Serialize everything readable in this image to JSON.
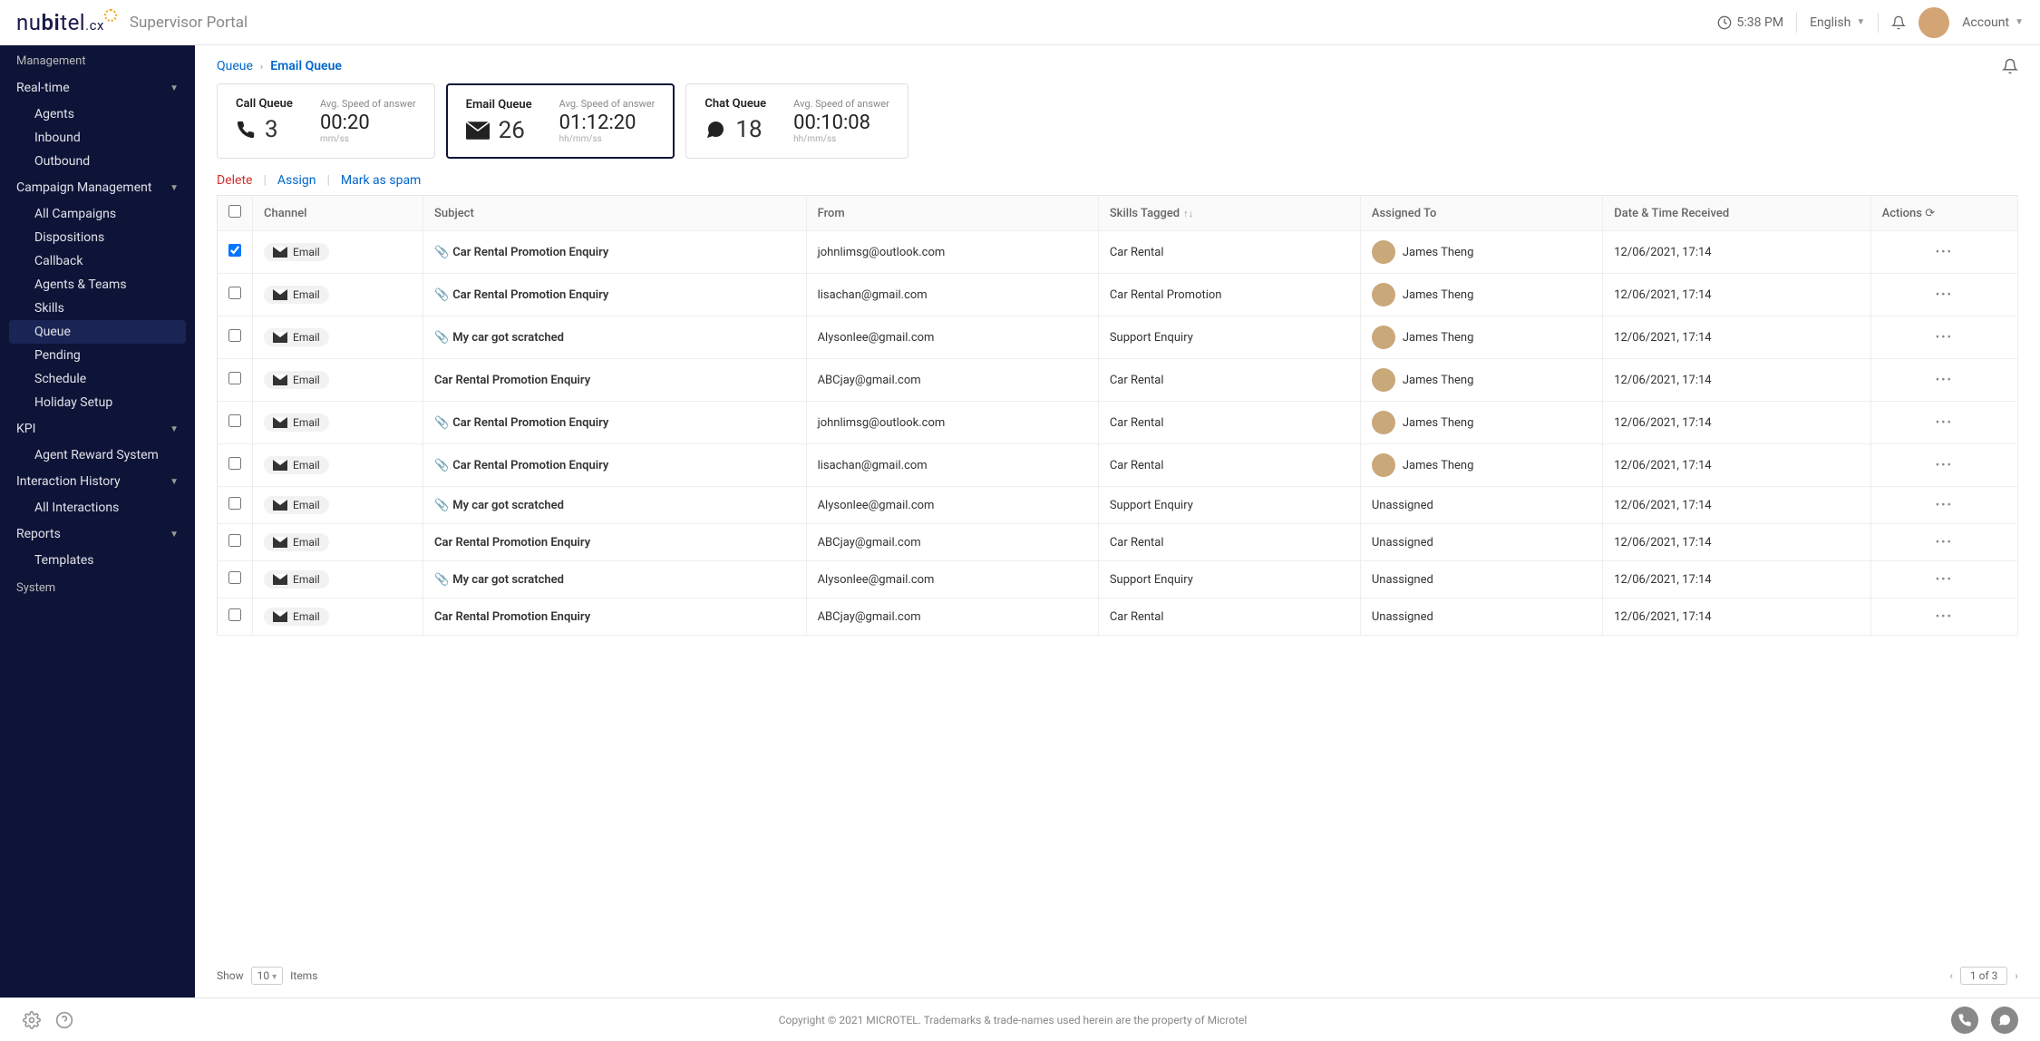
{
  "header": {
    "brand_a": "nu",
    "brand_b": "bi",
    "brand_c": "tel",
    "brand_sub": ".cx",
    "portal_title": "Supervisor Portal",
    "time": "5:38 PM",
    "language": "English",
    "account": "Account"
  },
  "breadcrumb": {
    "root": "Queue",
    "current": "Email Queue"
  },
  "sidebar": {
    "section_management": "Management",
    "groups": {
      "realtime": {
        "label": "Real-time",
        "items": [
          "Agents",
          "Inbound",
          "Outbound"
        ]
      },
      "campaign": {
        "label": "Campaign Management",
        "items": [
          "All Campaigns",
          "Dispositions",
          "Callback",
          "Agents & Teams",
          "Skills",
          "Queue",
          "Pending",
          "Schedule",
          "Holiday Setup"
        ]
      },
      "kpi": {
        "label": "KPI",
        "items": [
          "Agent Reward System"
        ]
      },
      "history": {
        "label": "Interaction History",
        "items": [
          "All Interactions"
        ]
      },
      "reports": {
        "label": "Reports",
        "items": [
          "Templates"
        ]
      }
    },
    "section_system": "System",
    "active_sub": "Queue"
  },
  "cards": [
    {
      "title": "Call Queue",
      "icon": "phone",
      "count": "3",
      "sublabel": "Avg. Speed of answer",
      "time": "00:20",
      "format": "mm/ss",
      "active": false
    },
    {
      "title": "Email Queue",
      "icon": "mail",
      "count": "26",
      "sublabel": "Avg. Speed of answer",
      "time": "01:12:20",
      "format": "hh/mm/ss",
      "active": true
    },
    {
      "title": "Chat Queue",
      "icon": "chat",
      "count": "18",
      "sublabel": "Avg. Speed of answer",
      "time": "00:10:08",
      "format": "hh/mm/ss",
      "active": false
    }
  ],
  "actions": {
    "delete": "Delete",
    "assign": "Assign",
    "spam": "Mark as spam"
  },
  "table": {
    "headers": {
      "channel": "Channel",
      "subject": "Subject",
      "from": "From",
      "skills": "Skills Tagged",
      "assigned": "Assigned To",
      "date": "Date & Time Received",
      "actions": "Actions"
    },
    "rows": [
      {
        "checked": true,
        "channel": "Email",
        "attach": true,
        "subject": "Car Rental Promotion Enquiry",
        "from": "johnlimsg@outlook.com",
        "skills": "Car Rental",
        "assigned": "James Theng",
        "avatar": true,
        "date": "12/06/2021, 17:14"
      },
      {
        "checked": false,
        "channel": "Email",
        "attach": true,
        "subject": "Car Rental Promotion Enquiry",
        "from": "lisachan@gmail.com",
        "skills": "Car Rental Promotion",
        "assigned": "James Theng",
        "avatar": true,
        "date": "12/06/2021, 17:14"
      },
      {
        "checked": false,
        "channel": "Email",
        "attach": true,
        "subject": "My car got scratched",
        "from": "Alysonlee@gmail.com",
        "skills": "Support Enquiry",
        "assigned": "James Theng",
        "avatar": true,
        "date": "12/06/2021, 17:14"
      },
      {
        "checked": false,
        "channel": "Email",
        "attach": false,
        "subject": "Car Rental Promotion Enquiry",
        "from": "ABCjay@gmail.com",
        "skills": "Car Rental",
        "assigned": "James Theng",
        "avatar": true,
        "date": "12/06/2021, 17:14"
      },
      {
        "checked": false,
        "channel": "Email",
        "attach": true,
        "subject": "Car Rental Promotion Enquiry",
        "from": "johnlimsg@outlook.com",
        "skills": "Car Rental",
        "assigned": "James Theng",
        "avatar": true,
        "date": "12/06/2021, 17:14"
      },
      {
        "checked": false,
        "channel": "Email",
        "attach": true,
        "subject": "Car Rental Promotion Enquiry",
        "from": "lisachan@gmail.com",
        "skills": "Car Rental",
        "assigned": "James Theng",
        "avatar": true,
        "date": "12/06/2021, 17:14"
      },
      {
        "checked": false,
        "channel": "Email",
        "attach": true,
        "subject": "My car got scratched",
        "from": "Alysonlee@gmail.com",
        "skills": "Support Enquiry",
        "assigned": "Unassigned",
        "avatar": false,
        "date": "12/06/2021, 17:14"
      },
      {
        "checked": false,
        "channel": "Email",
        "attach": false,
        "subject": "Car Rental Promotion Enquiry",
        "from": "ABCjay@gmail.com",
        "skills": "Car Rental",
        "assigned": "Unassigned",
        "avatar": false,
        "date": "12/06/2021, 17:14"
      },
      {
        "checked": false,
        "channel": "Email",
        "attach": true,
        "subject": "My car got scratched",
        "from": "Alysonlee@gmail.com",
        "skills": "Support Enquiry",
        "assigned": "Unassigned",
        "avatar": false,
        "date": "12/06/2021, 17:14"
      },
      {
        "checked": false,
        "channel": "Email",
        "attach": false,
        "subject": "Car Rental Promotion Enquiry",
        "from": "ABCjay@gmail.com",
        "skills": "Car Rental",
        "assigned": "Unassigned",
        "avatar": false,
        "date": "12/06/2021, 17:14"
      }
    ]
  },
  "pagination": {
    "show_label": "Show",
    "page_size": "10",
    "items_label": "Items",
    "indicator": "1 of 3"
  },
  "footer": {
    "copyright": "Copyright © 2021 MICROTEL. Trademarks & trade-names used herein are the property of Microtel"
  }
}
